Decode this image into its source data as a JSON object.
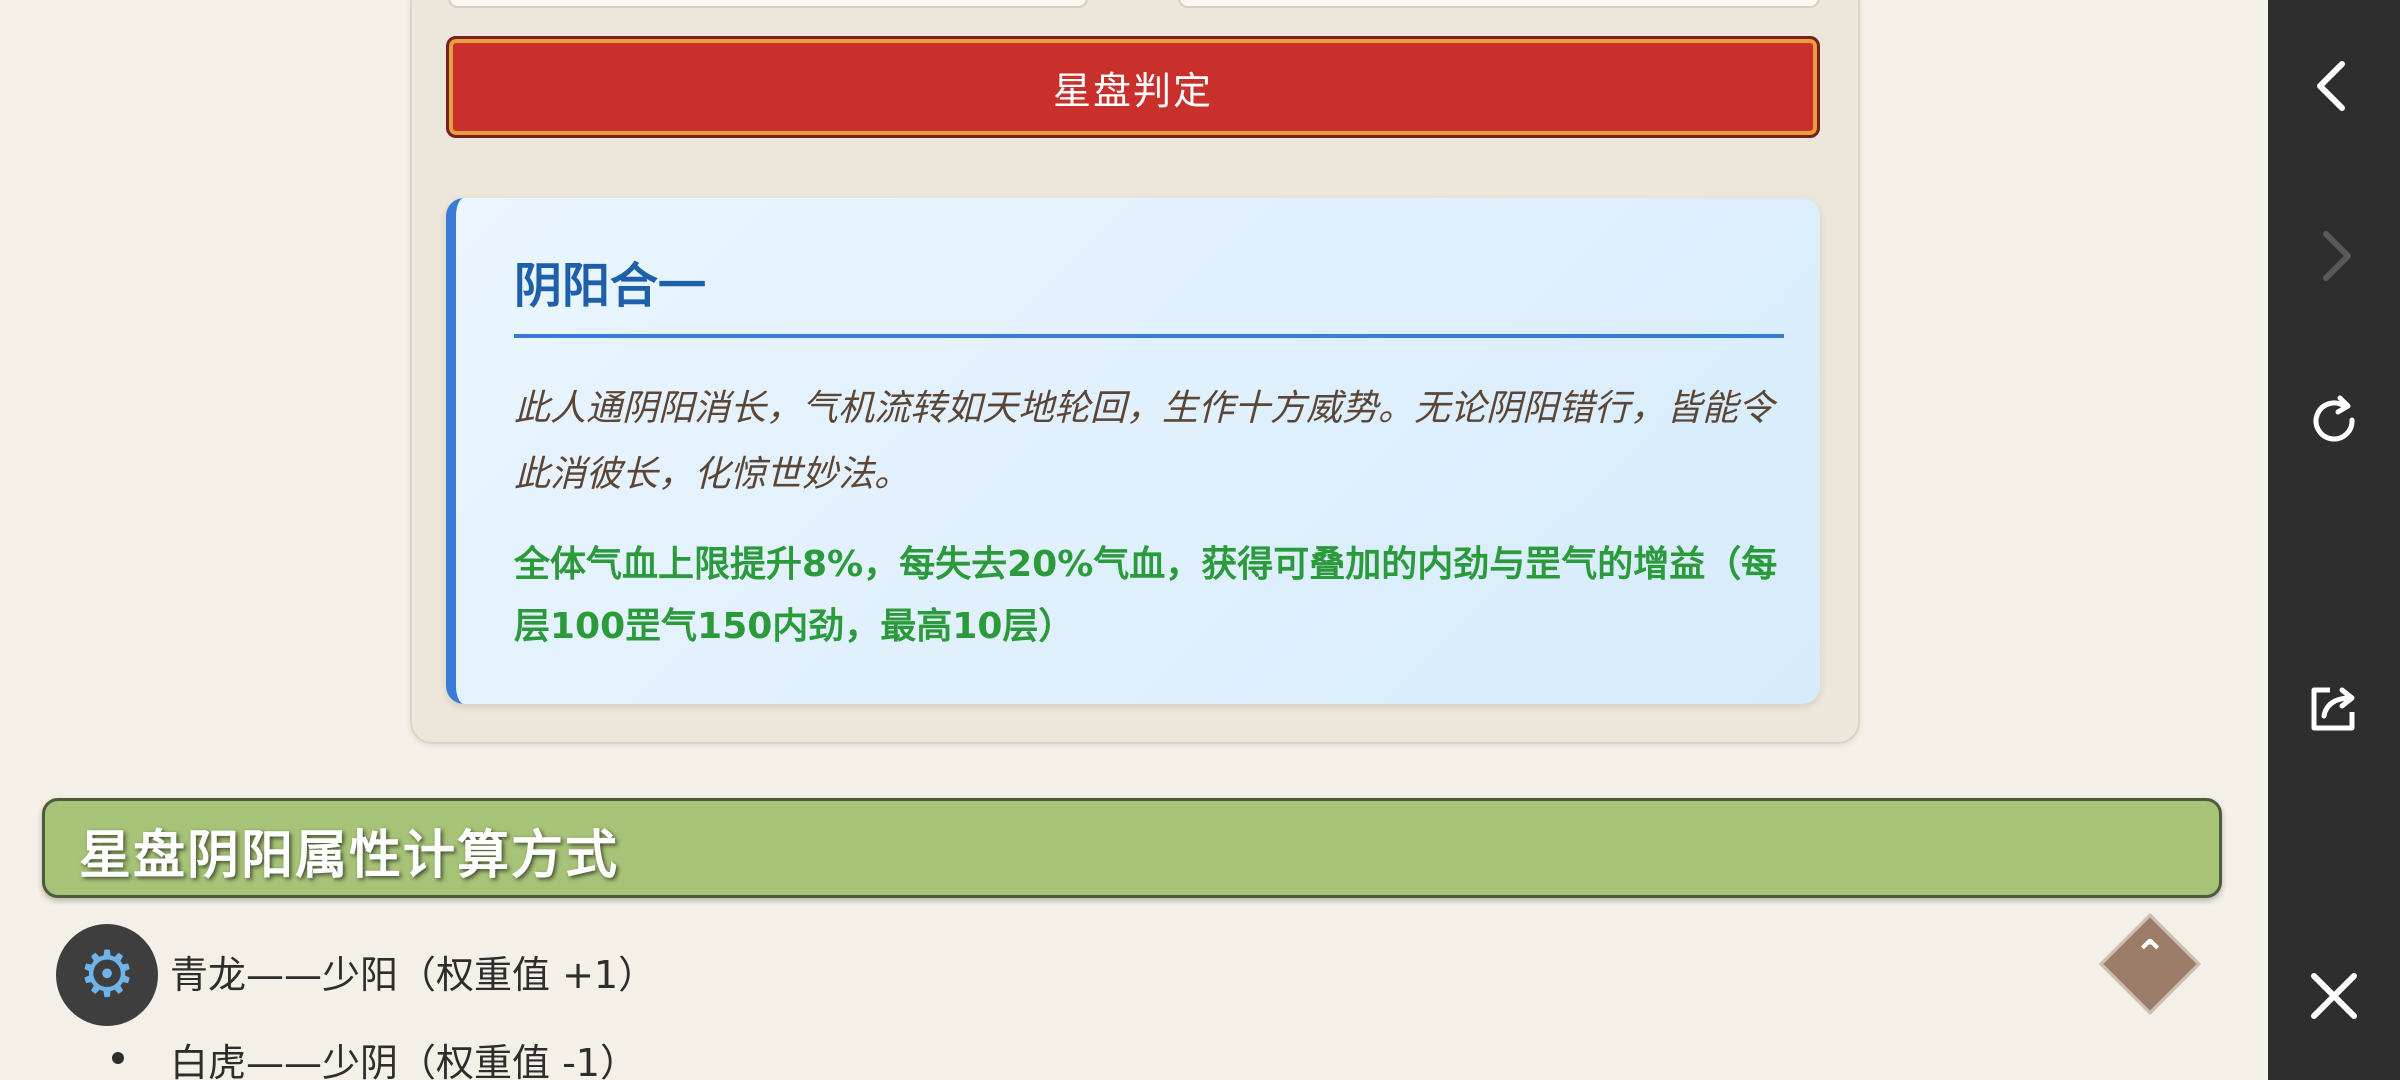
{
  "judge_button": {
    "label": "星盘判定"
  },
  "result": {
    "title": "阴阳合一",
    "description": "此人通阴阳消长，气机流转如天地轮回，生作十方威势。无论阴阳错行，皆能令此消彼长，化惊世妙法。",
    "effect": "全体气血上限提升8%，每失去20%气血，获得可叠加的内劲与罡气的增益（每层100罡气150内劲，最高10层）"
  },
  "section": {
    "title": "星盘阴阳属性计算方式"
  },
  "list": {
    "items": [
      {
        "label": "青龙——少阳（权重值 +1）"
      },
      {
        "label": "白虎——少阴（权重值 -1）"
      }
    ]
  },
  "icons": {
    "avatar": "gear-icon",
    "back_to_top": "chevron-up-icon",
    "rail": [
      "back-arrow-icon",
      "forward-arrow-icon",
      "refresh-icon",
      "share-icon",
      "close-icon"
    ]
  },
  "colors": {
    "button_red": "#c9302c",
    "panel_blue": "#3a7bd5",
    "effect_green": "#2a9a3a",
    "header_green": "#a7c377",
    "rail_bg": "#2e2e2e"
  }
}
